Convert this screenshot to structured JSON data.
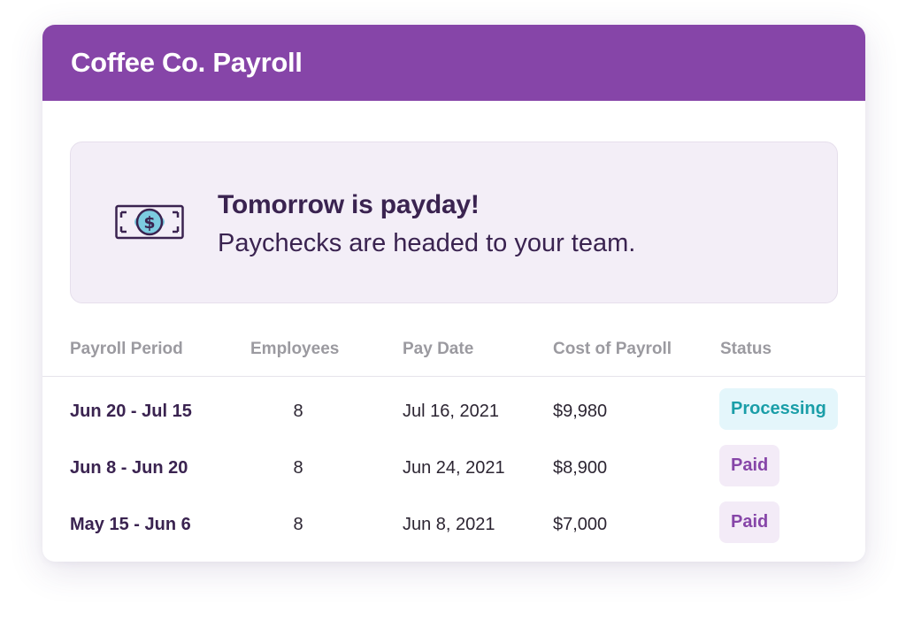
{
  "header": {
    "title": "Coffee Co. Payroll"
  },
  "banner": {
    "icon": "money-bill-icon",
    "title": "Tomorrow is payday!",
    "subtitle": "Paychecks are headed to your team."
  },
  "table": {
    "columns": [
      "Payroll Period",
      "Employees",
      "Pay Date",
      "Cost of Payroll",
      "Status"
    ],
    "rows": [
      {
        "period": "Jun 20 - Jul 15",
        "employees": "8",
        "pay_date": "Jul 16, 2021",
        "cost": "$9,980",
        "status": "Processing"
      },
      {
        "period": "Jun 8 - Jun 20",
        "employees": "8",
        "pay_date": "Jun 24, 2021",
        "cost": "$8,900",
        "status": "Paid"
      },
      {
        "period": "May 15 - Jun 6",
        "employees": "8",
        "pay_date": "Jun 8, 2021",
        "cost": "$7,000",
        "status": "Paid"
      }
    ]
  },
  "colors": {
    "header_bg": "#8645a8",
    "banner_bg": "#f3eef7",
    "processing_bg": "#e4f6fb",
    "processing_text": "#1a9ea8",
    "paid_bg": "#f3ebf7",
    "paid_text": "#8645a8"
  }
}
